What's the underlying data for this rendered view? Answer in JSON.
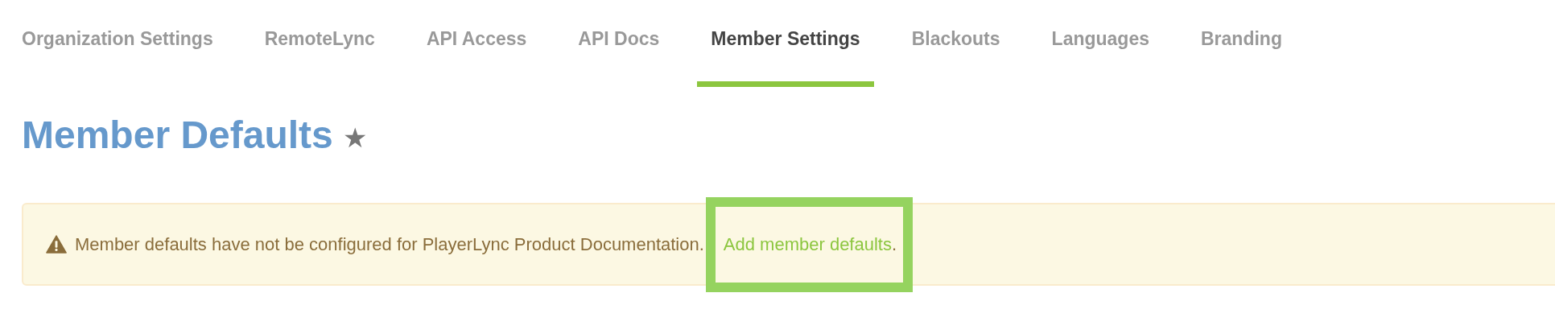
{
  "tabs": [
    {
      "label": "Organization Settings",
      "selected": false
    },
    {
      "label": "RemoteLync",
      "selected": false
    },
    {
      "label": "API Access",
      "selected": false
    },
    {
      "label": "API Docs",
      "selected": false
    },
    {
      "label": "Member Settings",
      "selected": true
    },
    {
      "label": "Blackouts",
      "selected": false
    },
    {
      "label": "Languages",
      "selected": false
    },
    {
      "label": "Branding",
      "selected": false
    }
  ],
  "heading": {
    "title": "Member Defaults",
    "star": "★"
  },
  "alert": {
    "message": "Member defaults have not be configured for PlayerLync Product Documentation.",
    "link": "Add member defaults",
    "trailing": ".",
    "highlighted": true
  }
}
